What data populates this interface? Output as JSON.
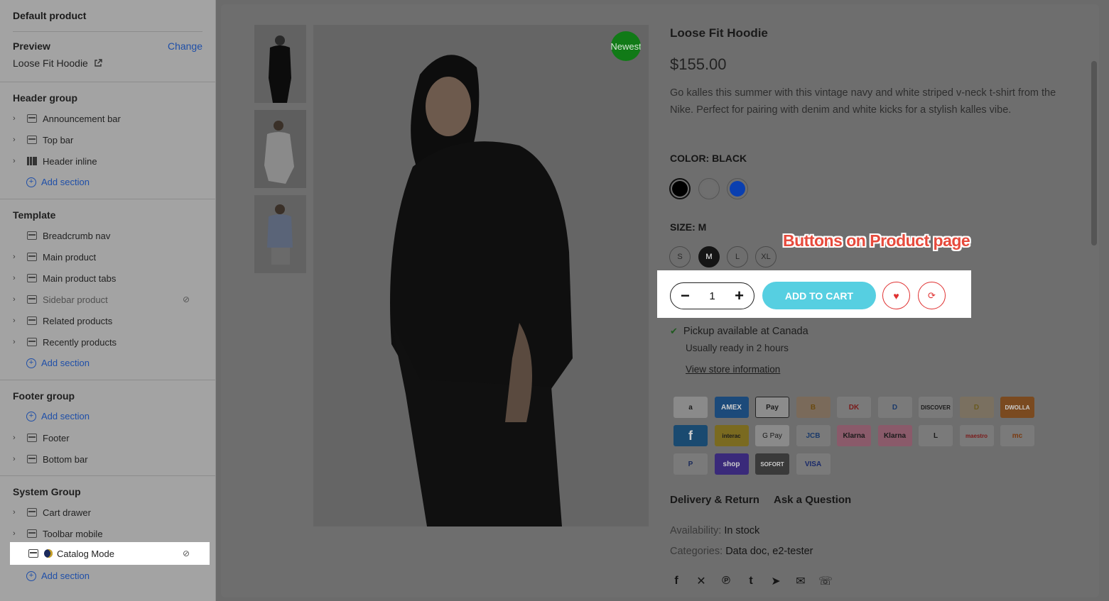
{
  "sidebar": {
    "title": "Default product",
    "preview": {
      "label": "Preview",
      "change": "Change",
      "value": "Loose Fit Hoodie"
    },
    "header_group": {
      "label": "Header group",
      "items": [
        "Announcement bar",
        "Top bar",
        "Header inline"
      ],
      "add": "Add section"
    },
    "template": {
      "label": "Template",
      "items": [
        "Breadcrumb nav",
        "Main product",
        "Main product tabs",
        "Sidebar product",
        "Related products",
        "Recently products"
      ],
      "add": "Add section"
    },
    "footer_group": {
      "label": "Footer group",
      "add": "Add section",
      "items": [
        "Footer",
        "Bottom bar"
      ]
    },
    "system_group": {
      "label": "System Group",
      "items": [
        "Cart drawer",
        "Toolbar mobile",
        "Catalog Mode"
      ],
      "add": "Add section"
    }
  },
  "product": {
    "badge": "Newest",
    "title": "Loose Fit Hoodie",
    "price": "$155.00",
    "description": "Go kalles this summer with this vintage navy and white striped v-neck t-shirt from the Nike. Perfect for pairing with denim and white kicks for a stylish kalles vibe.",
    "color_label": "COLOR: BLACK",
    "colors": [
      "#000000",
      "#ffffff",
      "#0a3fb0"
    ],
    "size_label": "SIZE: M",
    "sizes": [
      "S",
      "M",
      "L",
      "XL"
    ],
    "quantity": "1",
    "add_to_cart": "ADD TO CART",
    "pickup": "Pickup available at Canada",
    "ready": "Usually ready in 2 hours",
    "store_link": "View store information",
    "payments": [
      "a",
      "AMEX",
      "Pay",
      "B",
      "DK",
      "D",
      "DISCOVER",
      "D",
      "DWOLLA",
      "f",
      "interac",
      "G Pay",
      "JCB",
      "Klarna",
      "Klarna",
      "L",
      "maestro",
      "mc",
      "P",
      "shop",
      "SOFORT",
      "VISA"
    ],
    "tabs": [
      "Delivery & Return",
      "Ask a Question"
    ],
    "availability_label": "Availability:",
    "availability_value": "In stock",
    "categories_label": "Categories:",
    "categories_value": "Data doc, e2-tester"
  },
  "annotation": "Buttons on Product page",
  "accent_colors": {
    "add_to_cart": "#56cfe1",
    "wishlist": "#e03131",
    "annotation": "#e64a3c",
    "link": "#1f4fa8"
  }
}
